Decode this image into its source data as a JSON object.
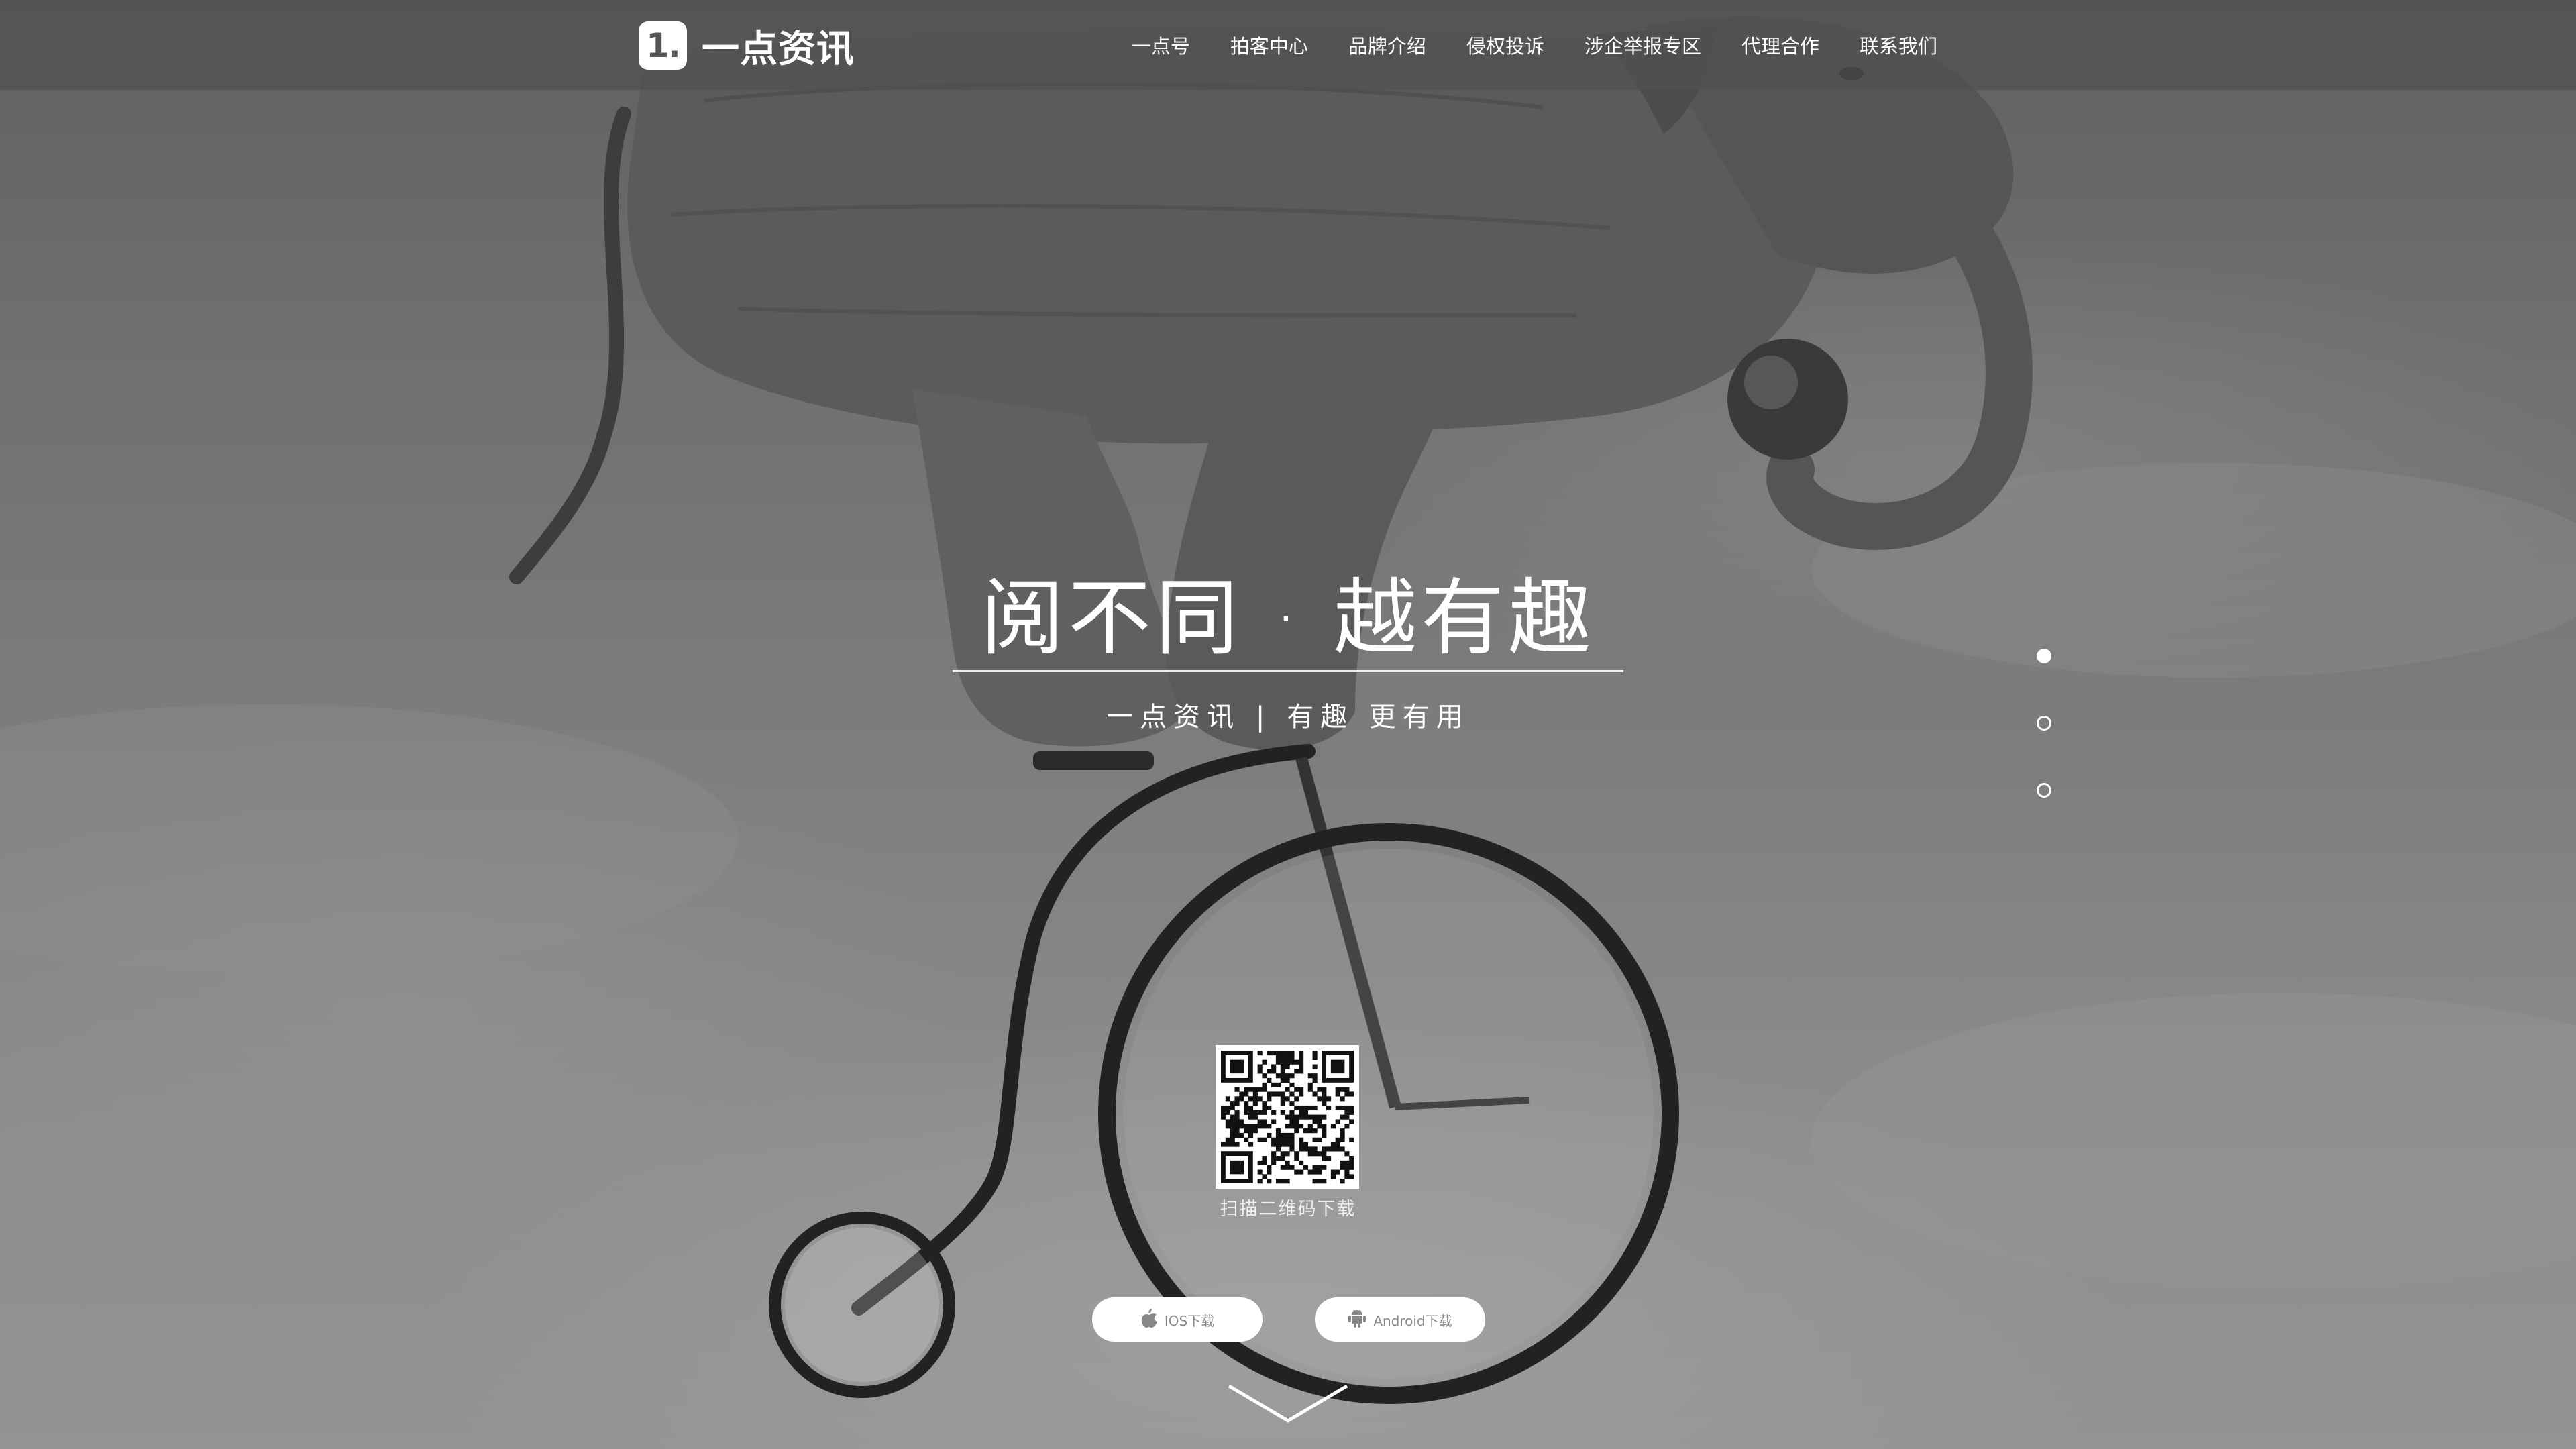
{
  "brand": {
    "mark": "1.",
    "name": "一点资讯"
  },
  "nav": {
    "items": [
      {
        "label": "一点号"
      },
      {
        "label": "拍客中心"
      },
      {
        "label": "品牌介绍"
      },
      {
        "label": "侵权投诉"
      },
      {
        "label": "涉企举报专区"
      },
      {
        "label": "代理合作"
      },
      {
        "label": "联系我们"
      }
    ]
  },
  "hero": {
    "headline": "阅不同 · 越有趣",
    "tagline": "一点资讯 | 有趣 更有用"
  },
  "slides": {
    "count": 3,
    "active_index": 0
  },
  "download": {
    "qr_caption": "扫描二维码下载",
    "ios_label": "IOS下载",
    "android_label": "Android下载"
  },
  "icons": {
    "ios": "apple-icon",
    "android": "android-icon",
    "scroll": "chevron-down-icon"
  },
  "colors": {
    "topbar": "#505050",
    "text": "#ffffff",
    "button_text": "#888888"
  }
}
